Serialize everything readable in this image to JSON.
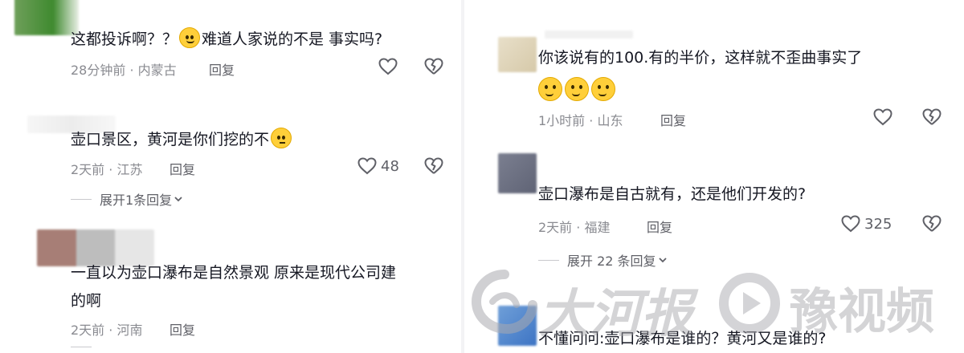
{
  "left_comments": [
    {
      "text": "这都投诉啊？？",
      "text_after_emoji": "难道人家说的不是 事实吗?",
      "meta": "28分钟前 · 内蒙古",
      "reply": "回复",
      "likes": ""
    },
    {
      "text": "壶口景区，黄河是你们挖的不",
      "meta": "2天前 · 江苏",
      "reply": "回复",
      "likes": "48",
      "expand": "展开1条回复"
    },
    {
      "text_line1": "一直以为壶口瀑布是自然景观   原来是现代公司建",
      "text_line2": "的啊",
      "meta": "2天前 · 河南",
      "reply": "回复",
      "likes": ""
    }
  ],
  "right_comments": [
    {
      "text": "你该说有的100.有的半价，这样就不歪曲事实了",
      "meta": "1小时前 · 山东",
      "reply": "回复",
      "likes": ""
    },
    {
      "text": "壶口瀑布是自古就有，还是他们开发的?",
      "meta": "2天前 · 福建",
      "reply": "回复",
      "likes": "325",
      "expand": "展开 22 条回复"
    },
    {
      "text": "不懂问问:壶口瀑布是谁的？黄河又是谁的?"
    }
  ],
  "icons": {
    "like": "heart-outline-icon",
    "dislike": "broken-heart-icon",
    "chevron": "chevron-down-icon",
    "emoji_laugh_cry": "laugh-cry-emoji-icon",
    "emoji_thinking": "thinking-emoji-icon",
    "emoji_cold_sweat": "cold-sweat-emoji-icon"
  },
  "watermark": {
    "brand1": "大河报",
    "brand2": "豫视频"
  },
  "colors": {
    "text": "#161823",
    "meta": "#8a8b91",
    "action": "#5f6067"
  }
}
